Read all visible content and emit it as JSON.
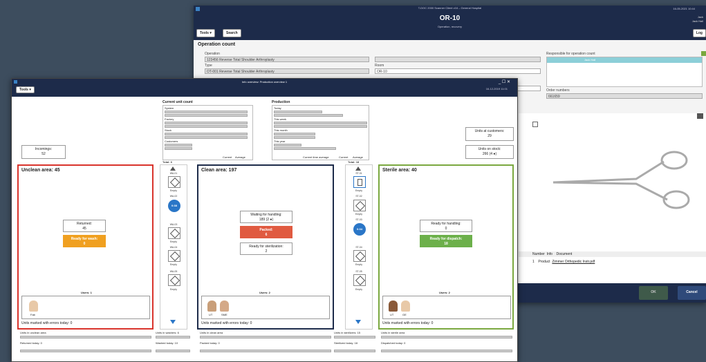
{
  "back": {
    "title_bar": "T-DOC 2000 Scanner Client v16 – General Hospital",
    "room": "OR-10",
    "subtitle": "Operation, recovery",
    "date": "16-05-2021 10:44",
    "user1": "Jack",
    "user2": "Jack Hall",
    "tools": "Tools ▾",
    "search": "Search",
    "logout": "Log",
    "section": "Operation count",
    "operation_label": "Operation",
    "operation_value": "123456 Reverse Total Shoulder Arthroplasty",
    "type_label": "Type",
    "type_value": "OT-001 Reverse Total Shoulder Arthroplasty",
    "room_label": "Room",
    "room_value": "OR-10",
    "resp_label": "Responsible for operation count",
    "resp_value": "Jack Hall",
    "order_label": "Order numbers",
    "order_value": "661659",
    "doc_number": "Number",
    "doc_info": "Info",
    "doc_document": "Document",
    "doc_row_num": "1",
    "doc_row_info": "Product",
    "doc_row_doc": "Zimmer Orthopedic Instr.pdf",
    "ok": "OK",
    "cancel": "Cancel"
  },
  "front": {
    "title": "Info overview: Production overview 1",
    "date": "16-12-2019 11:01",
    "tools": "Tools ▾",
    "cuc_title": "Current unit count",
    "cuc_rows": [
      "System",
      "Factory",
      "Stock",
      "Customers"
    ],
    "prod_title": "Production",
    "prod_rows": [
      "Today",
      "This week",
      "This month",
      "This year"
    ],
    "current": "Current",
    "average": "Average",
    "cur_time_avg": "Current time average",
    "incomings_label": "Incomings:",
    "incomings_value": "52",
    "customers_label": "Units at customers:",
    "customers_value": "29",
    "stock_label": "Units on stock:",
    "stock_value": "266 (4 ●)",
    "unclean_title": "Unclean area: 45",
    "returned_label": "Returned:",
    "returned_value": "45",
    "ready_wash_label": "Ready for wash:",
    "ready_wash_value": "0",
    "unclean_users": "Users: 1",
    "unclean_errors": "Units marked with errors today: 0",
    "wash_total": "Total: 6",
    "wash_labels": [
      "WA-01",
      "WA-02",
      "WA-03",
      "WA-04",
      "WA-05"
    ],
    "wash_status": "Empty",
    "wash_running": "0:38",
    "clean_title": "Clean area: 197",
    "waiting_label": "Waiting for handling:",
    "waiting_value": "189 (2 ●)",
    "packed_label": "Packed:",
    "packed_value": "6",
    "ready_ster_label": "Ready for sterilization:",
    "ready_ster_value": "2",
    "clean_users": "Users: 2",
    "clean_errors": "Units marked with errors today: 0",
    "ster_total": "Total: 18",
    "ster_labels": [
      "ST-01",
      "ST-02",
      "ST-03",
      "ST-04",
      "ST-05"
    ],
    "ster_running": "0:34",
    "sterile_title": "Sterile area: 40",
    "ready_handle_label": "Ready for handling:",
    "ready_handle_value": "0",
    "ready_disp_label": "Ready for dispatch:",
    "ready_disp_value": "18",
    "sterile_users": "Users: 2",
    "sterile_errors": "Units marked with errors today: 0",
    "bottom": [
      "Units in unclean area",
      "Units in washers: 6",
      "Units in clean area",
      "Units in sterilizers: 15",
      "Units in sterile area"
    ],
    "bottom2": [
      "Returned today: 0",
      "Washed today: 10",
      "Packed today: 0",
      "Sterilized today: 18",
      "Dispatched today: 0"
    ],
    "user_labels": [
      "Fab",
      "UT",
      "SME",
      "UT",
      "GE"
    ]
  },
  "colors": {
    "unclean": "#d9332b",
    "clean": "#1d2b4a",
    "sterile": "#7aa83f",
    "orange": "#f0a020",
    "red": "#e05a40",
    "green": "#6cb04a"
  }
}
